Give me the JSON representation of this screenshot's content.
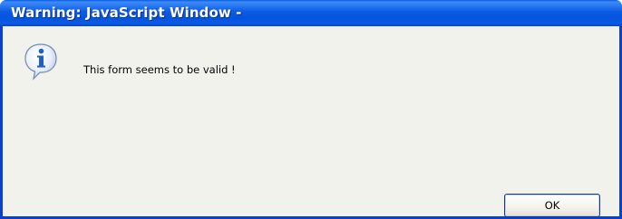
{
  "window": {
    "title": "Warning: JavaScript Window -"
  },
  "dialog": {
    "icon": "info-icon",
    "message": "This form seems to be valid !",
    "ok_label": "OK"
  },
  "colors": {
    "titlebar": "#0a5be6",
    "client_background": "#f2f2ec",
    "icon_blue": "#1b5fc7"
  }
}
